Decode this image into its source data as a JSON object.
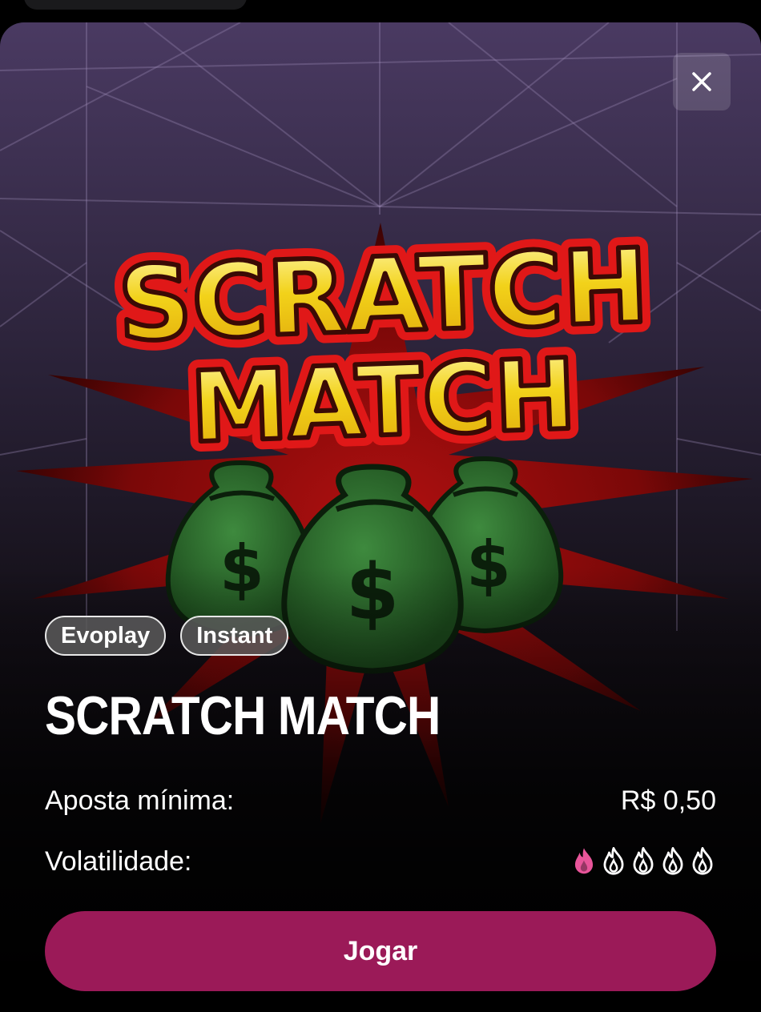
{
  "modal": {
    "close_icon": "close-icon",
    "game_art_logo_text": [
      "SCRATCH",
      "MATCH"
    ],
    "tags": [
      "Evoplay",
      "Instant"
    ],
    "title": "SCRATCH MATCH",
    "min_bet_label": "Aposta mínima:",
    "min_bet_value": "R$ 0,50",
    "volatility_label": "Volatilidade:",
    "volatility": {
      "level": 1,
      "max": 5,
      "icon": "flame-icon",
      "active_color": "#e8559a",
      "inactive_color": "#ffffff"
    },
    "play_label": "Jogar",
    "play_color": "#9b1a58"
  }
}
